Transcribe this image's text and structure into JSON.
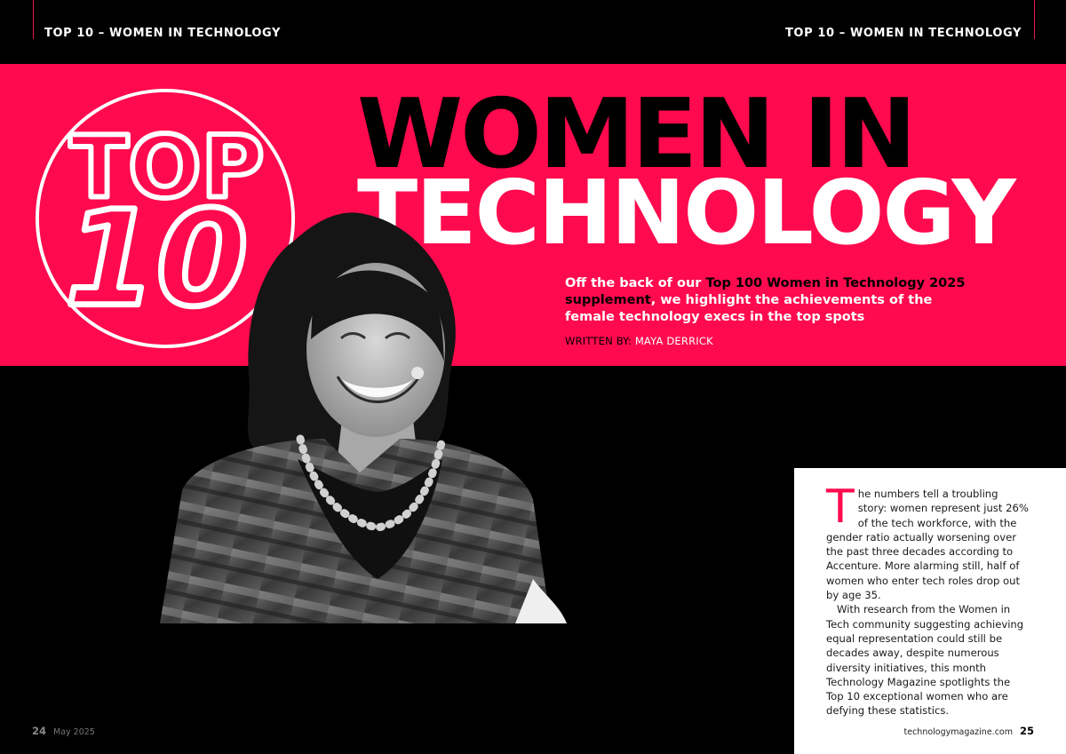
{
  "header": {
    "left_label": "TOP 10 – WOMEN IN TECHNOLOGY",
    "right_label": "TOP 10 – WOMEN IN TECHNOLOGY"
  },
  "badge": {
    "line1": "TOP",
    "line2": "10"
  },
  "headline": {
    "line1": "WOMEN IN",
    "line2": "TECHNOLOGY"
  },
  "standfirst": {
    "part1": "Off the back of our ",
    "highlight": "Top 100 Women in Technology 2025 supplement",
    "part2": ", we highlight the achievements of the female technology execs in the top spots"
  },
  "byline": {
    "label": "WRITTEN BY: ",
    "author": "MAYA DERRICK"
  },
  "photo": {
    "icon": "portrait-photo"
  },
  "article": {
    "dropcap": "T",
    "para1": "he numbers tell a troubling story: women represent just 26% of the tech workforce, with the gender ratio actually worsening over the past three decades according to Accenture. More alarming still, half of women who enter tech roles drop out by age 35.",
    "para2": "With research from the Women in Tech community suggesting achieving equal representation could still be decades away, despite numerous diversity initiatives, this month Technology Magazine spotlights the Top 10 exceptional women who are defying these statistics."
  },
  "footer": {
    "left_page": "24",
    "left_date": "May 2025",
    "right_site": "technologymagazine.com",
    "right_page": "25"
  },
  "colors": {
    "accent": "#ff0a4e",
    "dark": "#000000",
    "light": "#ffffff"
  }
}
